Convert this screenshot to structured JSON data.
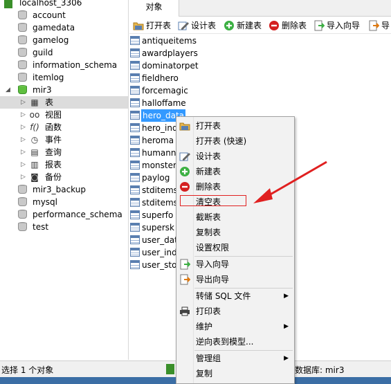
{
  "tree": {
    "connection": "localhost_3306",
    "databases_top": [
      {
        "id": "account",
        "label": "account"
      },
      {
        "id": "gamedata",
        "label": "gamedata"
      },
      {
        "id": "gamelog",
        "label": "gamelog"
      },
      {
        "id": "guild",
        "label": "guild"
      },
      {
        "id": "information-schema",
        "label": "information_schema"
      },
      {
        "id": "itemlog",
        "label": "itemlog"
      }
    ],
    "open_db": "mir3",
    "open_db_children": [
      {
        "id": "tables",
        "label": "表",
        "icon": "table-icon"
      },
      {
        "id": "views",
        "label": "视图",
        "icon": "glasses-icon"
      },
      {
        "id": "functions",
        "label": "函数",
        "icon": "function-icon"
      },
      {
        "id": "events",
        "label": "事件",
        "icon": "clock-icon"
      },
      {
        "id": "queries",
        "label": "查询",
        "icon": "query-icon"
      },
      {
        "id": "reports",
        "label": "报表",
        "icon": "report-icon"
      },
      {
        "id": "backups",
        "label": "备份",
        "icon": "backup-icon"
      }
    ],
    "databases_bottom": [
      {
        "id": "mir3-backup",
        "label": "mir3_backup"
      },
      {
        "id": "mysql",
        "label": "mysql"
      },
      {
        "id": "performance-schema",
        "label": "performance_schema"
      },
      {
        "id": "test",
        "label": "test"
      }
    ]
  },
  "tabs": {
    "objects": "对象"
  },
  "toolbar": {
    "open_table": "打开表",
    "design_table": "设计表",
    "new_table": "新建表",
    "delete_table": "删除表",
    "import_wizard": "导入向导",
    "export_wizard": "导"
  },
  "objects": [
    "antiqueitems",
    "awardplayers",
    "dominatorpet",
    "fieldhero",
    "forcemagic",
    "halloffame",
    "hero_data",
    "hero_ind",
    "heroma",
    "humann",
    "monster",
    "paylog",
    "stditems",
    "stditems",
    "superfo",
    "supersk",
    "user_dat",
    "user_ind",
    "user_sto"
  ],
  "selected_object": "hero_data",
  "context_menu": {
    "open_table": "打开表",
    "open_table_fast": "打开表 (快速)",
    "design_table": "设计表",
    "new_table": "新建表",
    "delete_table": "删除表",
    "empty_table": "清空表",
    "truncate_table": "截断表",
    "copy_table": "复制表",
    "set_permissions": "设置权限",
    "import_wizard": "导入向导",
    "export_wizard": "导出向导",
    "dump_sql": "转储 SQL 文件",
    "print_table": "打印表",
    "maintain": "维护",
    "reverse_model": "逆向表到模型...",
    "manage_group": "管理组",
    "copy": "复制",
    "submenu_arrow": "▶"
  },
  "status": {
    "left": "选择 1 个对象",
    "right": "数据库: mir3"
  },
  "colors": {
    "selection": "#3399ff",
    "highlight_box": "#e02020",
    "annotation_arrow": "#e02020",
    "db_green": "#5fbf3f"
  }
}
